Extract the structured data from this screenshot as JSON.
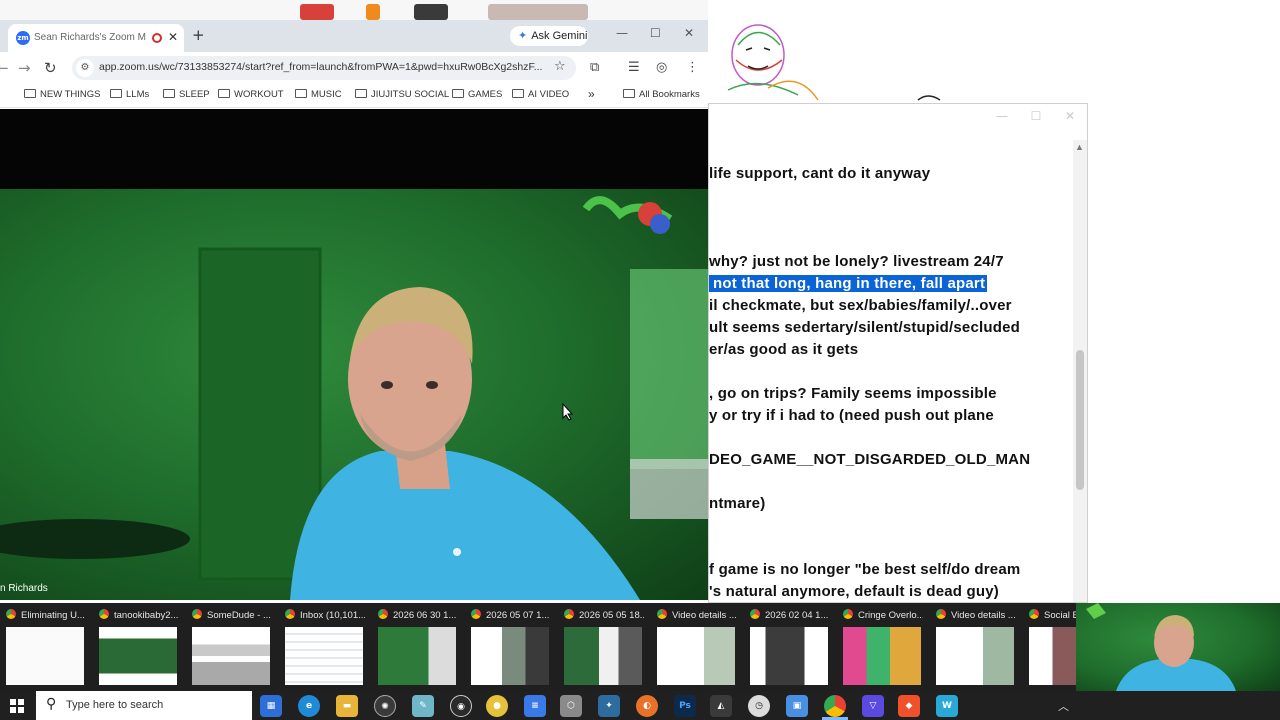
{
  "browser": {
    "tab_title": "Sean Richards's Zoom Meeti",
    "tab_close": "✕",
    "new_tab": "+",
    "gemini_label": "Ask Gemini",
    "url": "app.zoom.us/wc/73133853274/start?ref_from=launch&fromPWA=1&pwd=hxuRw0BcXg2shzF...",
    "window_controls": {
      "minimize": "—",
      "maximize": "☐",
      "close": "✕"
    },
    "bookmarks": [
      "NEW THINGS",
      "LLMs",
      "SLEEP",
      "WORKOUT",
      "MUSIC",
      "JIUJITSU SOCIAL",
      "GAMES",
      "AI VIDEO"
    ],
    "bookmarks_overflow": "»",
    "all_bookmarks": "All Bookmarks"
  },
  "zoom": {
    "participant_name": "n Richards"
  },
  "notes": {
    "lines": [
      {
        "text": "life support, cant do it anyway",
        "highlight": false
      },
      {
        "text": "why? just not be lonely? livestream 24/7",
        "highlight": false
      },
      {
        "text": "not that long, hang in there, fall apart",
        "highlight": true
      },
      {
        "text": "il checkmate, but sex/babies/family/..over",
        "highlight": false
      },
      {
        "text": "ult seems sedertary/silent/stupid/secluded",
        "highlight": false
      },
      {
        "text": "er/as good as it gets",
        "highlight": false
      },
      {
        "text": ", go on trips? Family seems impossible",
        "highlight": false
      },
      {
        "text": "y or try if i had to (need push out plane",
        "highlight": false
      },
      {
        "text": "DEO_GAME__NOT_DISGARDED_OLD_MAN",
        "highlight": false
      },
      {
        "text": "ntmare)",
        "highlight": false
      },
      {
        "text": "f game is no longer \"be best self/do dream",
        "highlight": false
      },
      {
        "text": "'s natural anymore, default is dead guy)",
        "highlight": false
      }
    ]
  },
  "previews": [
    "Eliminating U...",
    "tanookibaby2...",
    "SomeDude - ...",
    "Inbox (10,101...",
    "2026 06 30 1...",
    "2026 05 07 1...",
    "2026 05 05 18...",
    "Video details ...",
    "2026 02 04 1...",
    "Cringe Overlo...",
    "Video details ...",
    "Social E"
  ],
  "taskbar": {
    "search_placeholder": "Type here to search",
    "search_icon": "⚲"
  },
  "colors": {
    "highlight": "#0a64d6",
    "tabstrip": "#dee3ea",
    "taskbar": "#202020",
    "zoom_green": "#1f6e2c"
  }
}
